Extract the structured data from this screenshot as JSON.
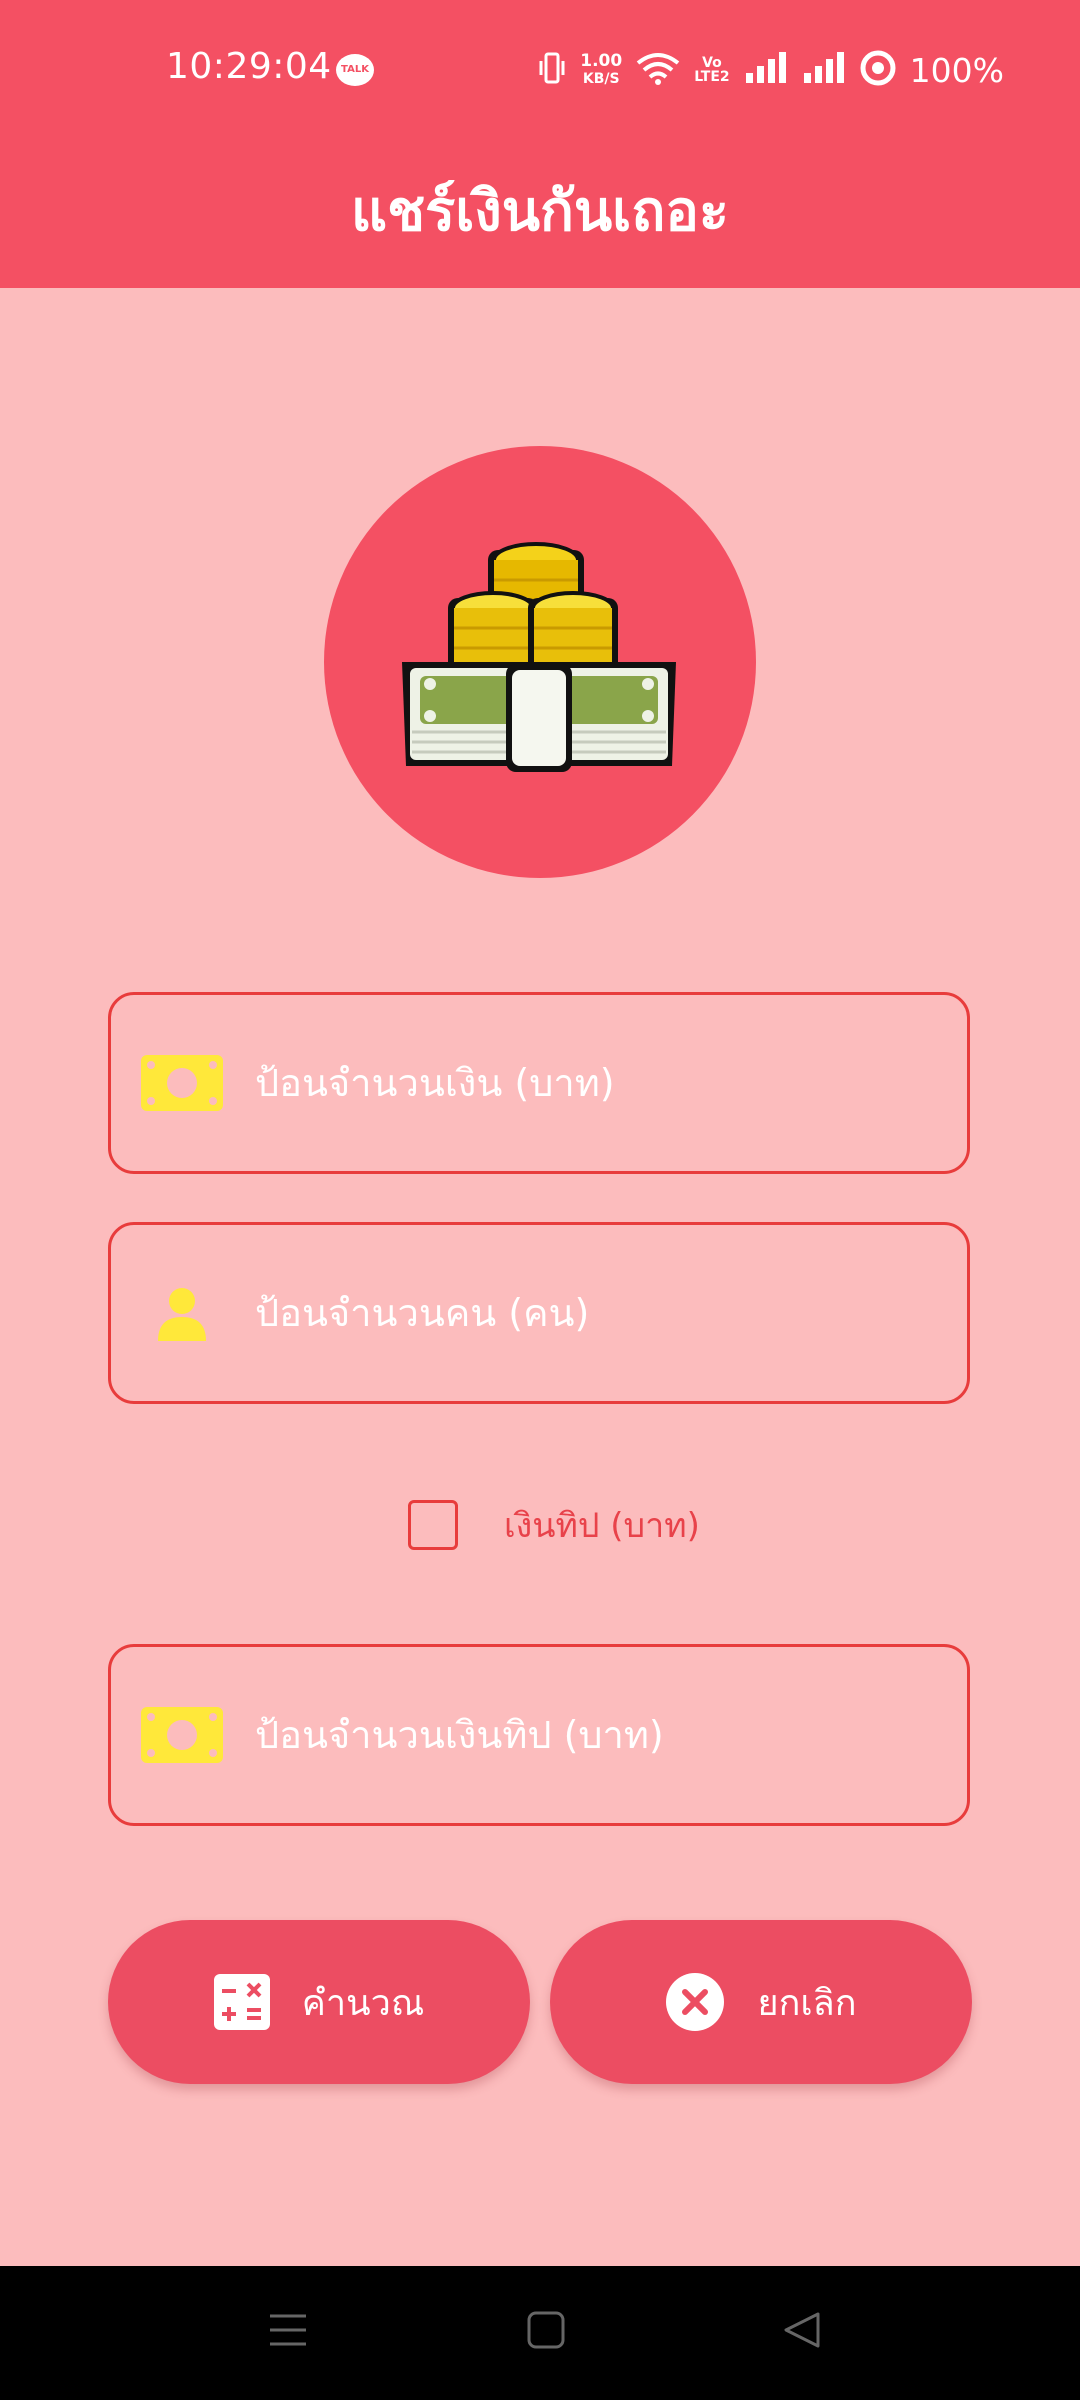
{
  "status_bar": {
    "time": "10:29:04",
    "talk_badge": "TALK",
    "net_speed": "1.00",
    "net_unit": "KB/S",
    "volte_top": "Vo",
    "volte_bottom": "LTE2",
    "battery": "100%"
  },
  "app_bar": {
    "title": "แชร์เงินกันเถอะ"
  },
  "form": {
    "amount_placeholder": "ป้อนจำนวนเงิน (บาท)",
    "people_placeholder": "ป้อนจำนวนคน (คน)",
    "tip_checkbox_label": "เงินทิป (บาท)",
    "tip_checked": false,
    "tip_placeholder": "ป้อนจำนวนเงินทิป (บาท)"
  },
  "buttons": {
    "calculate_label": "คำนวณ",
    "cancel_label": "ยกเลิก"
  },
  "icons": {
    "hero": "money-coins-icon",
    "amount": "money-icon",
    "people": "person-icon",
    "tip": "money-icon",
    "calculate": "calculator-icon",
    "cancel": "close-circle-icon"
  },
  "colors": {
    "primary": "#f45063",
    "background": "#fcbcbd",
    "accent_border": "#e83c3c",
    "icon_yellow": "#ffe83a",
    "button": "#ec4d62"
  }
}
